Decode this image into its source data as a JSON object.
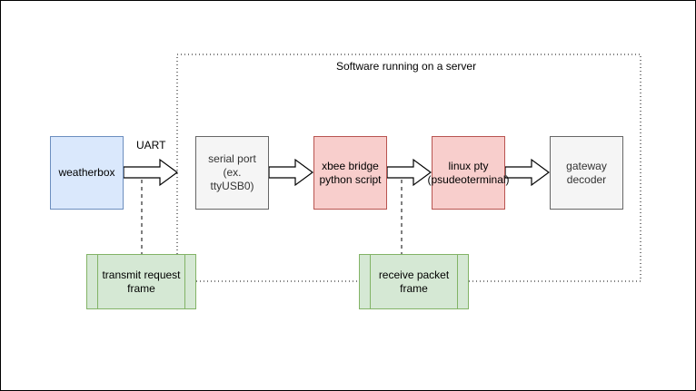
{
  "container": {
    "label": "Software running on a server"
  },
  "edge_labels": {
    "uart": "UART"
  },
  "nodes": {
    "weatherbox": "weatherbox",
    "serial_port": "serial port (ex.\nttyUSB0)",
    "xbee_bridge": "xbee bridge\npython script",
    "linux_pty": "linux pty\n(psudeoterminal)",
    "gateway_decoder": "gateway\ndecoder",
    "transmit_request": "transmit request\nframe",
    "receive_packet": "receive packet\nframe"
  },
  "colors": {
    "blue_fill": "#dae8fc",
    "blue_stroke": "#6c8ebf",
    "red_fill": "#f8cecc",
    "red_stroke": "#b85450",
    "gray_fill": "#f5f5f5",
    "gray_stroke": "#666666",
    "green_fill": "#d5e8d4",
    "green_stroke": "#82b366"
  }
}
